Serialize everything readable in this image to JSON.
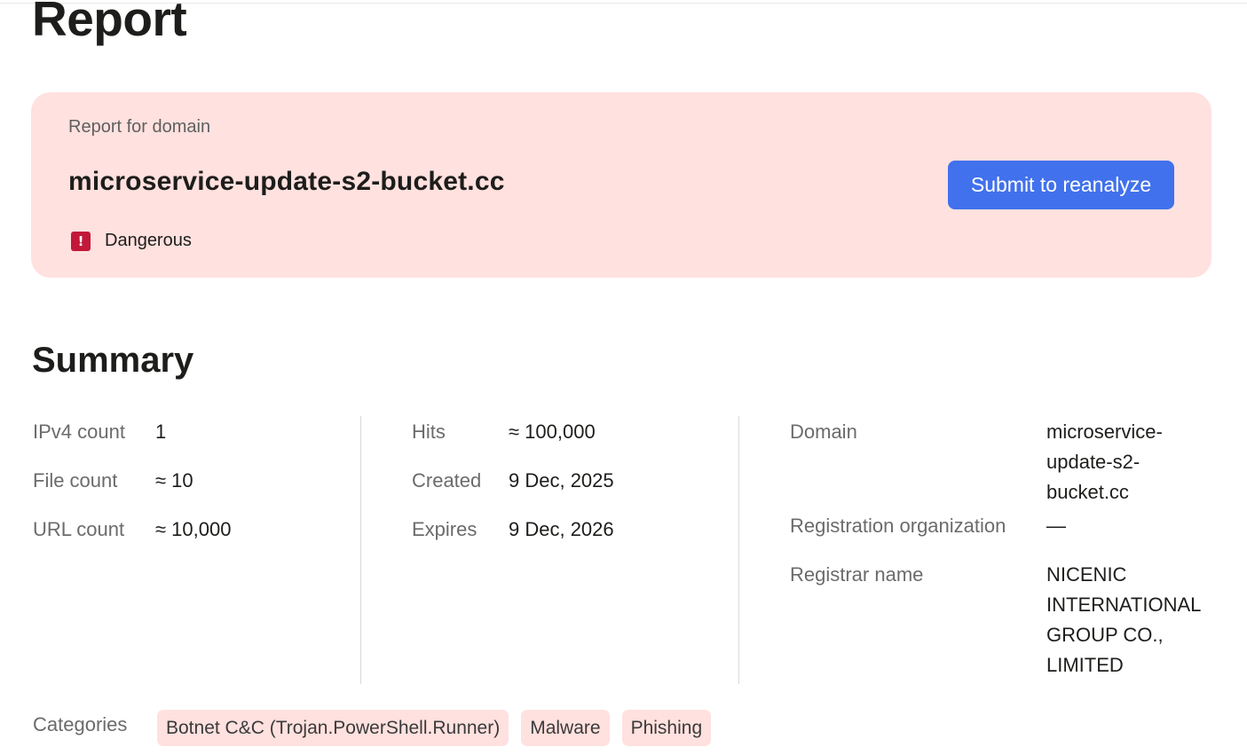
{
  "page": {
    "title": "Report"
  },
  "report": {
    "label": "Report for domain",
    "domain": "microservice-update-s2-bucket.cc",
    "verdict": "Dangerous",
    "verdict_icon_glyph": "!",
    "verdict_icon": "warning-square-icon",
    "reanalyze_label": "Submit to reanalyze"
  },
  "summary": {
    "title": "Summary",
    "col1": [
      {
        "label": "IPv4 count",
        "value": "1"
      },
      {
        "label": "File count",
        "value": "≈ 10"
      },
      {
        "label": "URL count",
        "value": "≈ 10,000"
      }
    ],
    "col2": [
      {
        "label": "Hits",
        "value": "≈ 100,000"
      },
      {
        "label": "Created",
        "value": "9 Dec, 2025"
      },
      {
        "label": "Expires",
        "value": "9 Dec, 2026"
      }
    ],
    "col3": [
      {
        "label": "Domain",
        "value": "microservice-update-s2-bucket.cc"
      },
      {
        "label": "Registration organization",
        "value": "—"
      },
      {
        "label": "Registrar name",
        "value": "NICENIC INTERNATIONAL GROUP CO., LIMITED"
      }
    ],
    "categories_label": "Categories",
    "categories": [
      "Botnet C&C (Trojan.PowerShell.Runner)",
      "Malware",
      "Phishing"
    ]
  },
  "colors": {
    "card_background": "#ffe1df",
    "danger": "#c2183a",
    "primary_button": "#4171ec"
  }
}
